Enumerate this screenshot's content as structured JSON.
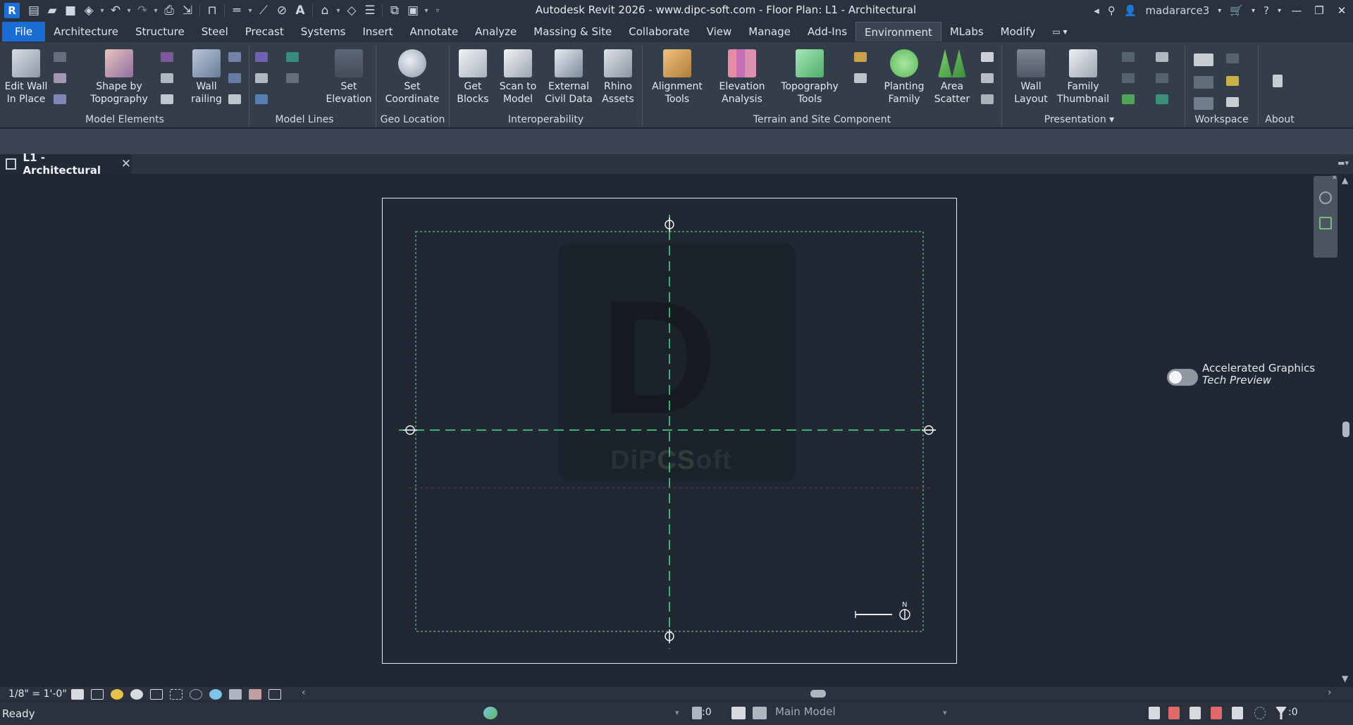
{
  "window": {
    "title": "Autodesk Revit 2026 - www.dipc-soft.com - Floor Plan: L1 - Architectural",
    "user": "madararce3",
    "app_letter": "R"
  },
  "ribbon_tabs": [
    "File",
    "Architecture",
    "Structure",
    "Steel",
    "Precast",
    "Systems",
    "Insert",
    "Annotate",
    "Analyze",
    "Massing & Site",
    "Collaborate",
    "View",
    "Manage",
    "Add-Ins",
    "Environment",
    "MLabs",
    "Modify"
  ],
  "active_tab": "Environment",
  "panels": [
    {
      "label": "Model Elements",
      "buttons": [
        "Edit Wall\nIn Place",
        "Shape by\nTopography",
        "Wall\nrailing"
      ]
    },
    {
      "label": "Model Lines",
      "buttons": [
        "Set\nElevation"
      ]
    },
    {
      "label": "Geo Location",
      "buttons": [
        "Set\nCoordinate"
      ]
    },
    {
      "label": "Interoperability",
      "buttons": [
        "Get\nBlocks",
        "Scan to\nModel",
        "External\nCivil Data",
        "Rhino\nAssets"
      ]
    },
    {
      "label": "Terrain and Site Component",
      "buttons": [
        "Alignment\nTools",
        "Elevation\nAnalysis",
        "Topography\nTools",
        "Planting\nFamily",
        "Area\nScatter"
      ]
    },
    {
      "label": "Presentation",
      "buttons": [
        "Wall\nLayout",
        "Family\nThumbnail"
      ]
    },
    {
      "label": "Workspace",
      "buttons": []
    },
    {
      "label": "About",
      "buttons": []
    }
  ],
  "view_tab": {
    "label": "L1 - Architectural",
    "close": "✕"
  },
  "accelerated": {
    "title": "Accelerated Graphics",
    "subtitle": "Tech Preview",
    "enabled": false
  },
  "watermark": {
    "letter": "D",
    "text_a": "DiP",
    "text_b": "CS",
    "text_c": "oft"
  },
  "view_control": {
    "scale": "1/8\" = 1'-0\""
  },
  "status": {
    "text": "Ready",
    "workset_count": ":0",
    "model": "Main Model",
    "filter_count": ":0"
  },
  "north_arrow": {
    "letter": "N"
  },
  "colors": {
    "accent": "#1a6dd4",
    "grid": "#4fdc8a",
    "frame": "#e6eaee",
    "crop": "#7fd9a0"
  }
}
